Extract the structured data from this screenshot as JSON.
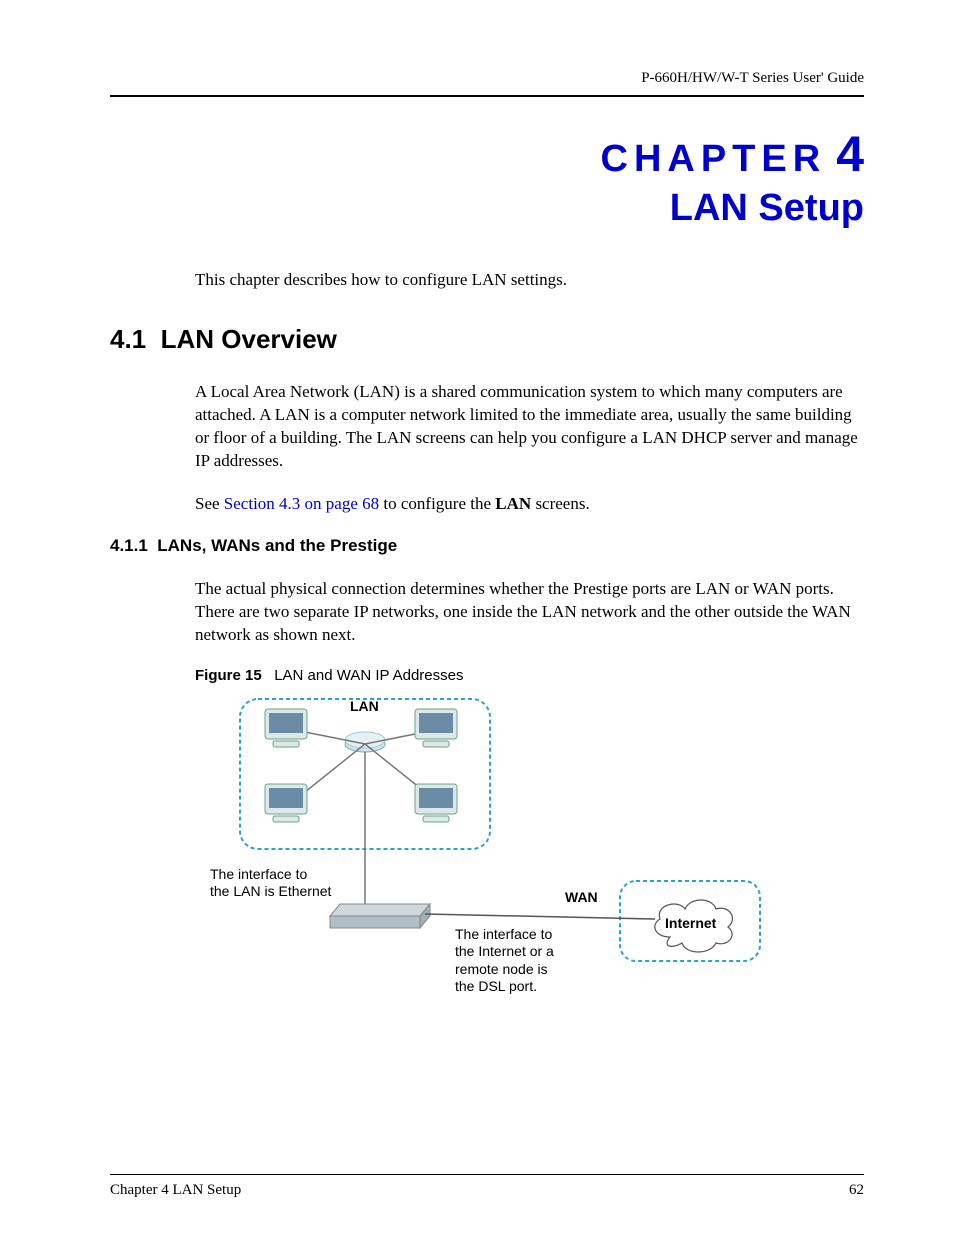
{
  "header": {
    "guide": "P-660H/HW/W-T Series User' Guide"
  },
  "chapter": {
    "label": "CHAPTER",
    "number": "4",
    "title": "LAN Setup"
  },
  "intro": "This chapter describes how to configure LAN settings.",
  "section1": {
    "number": "4.1",
    "title": "LAN Overview",
    "p1": "A Local Area Network (LAN) is a shared communication system to which many computers are attached. A LAN is a computer network limited to the immediate area, usually the same building or floor of a building. The LAN screens can help you configure a LAN DHCP server and manage IP addresses.",
    "p2_pre": "See ",
    "p2_link": "Section 4.3 on page 68",
    "p2_mid": " to configure the ",
    "p2_bold": "LAN",
    "p2_post": " screens."
  },
  "section11": {
    "number": "4.1.1",
    "title": "LANs, WANs and the Prestige",
    "p1": "The actual physical connection determines whether the Prestige ports are LAN or WAN ports. There are two separate IP networks, one inside the LAN network and the other outside the WAN network as shown next."
  },
  "figure": {
    "label": "Figure 15",
    "title": "LAN and WAN IP Addresses",
    "lan_label": "LAN",
    "wan_label": "WAN",
    "internet_label": "Internet",
    "left_text_l1": "The interface to",
    "left_text_l2": "the LAN is Ethernet",
    "right_text_l1": "The interface to",
    "right_text_l2": "the Internet or a",
    "right_text_l3": "remote node is",
    "right_text_l4": "the DSL port."
  },
  "footer": {
    "left": "Chapter 4 LAN Setup",
    "right": "62"
  }
}
